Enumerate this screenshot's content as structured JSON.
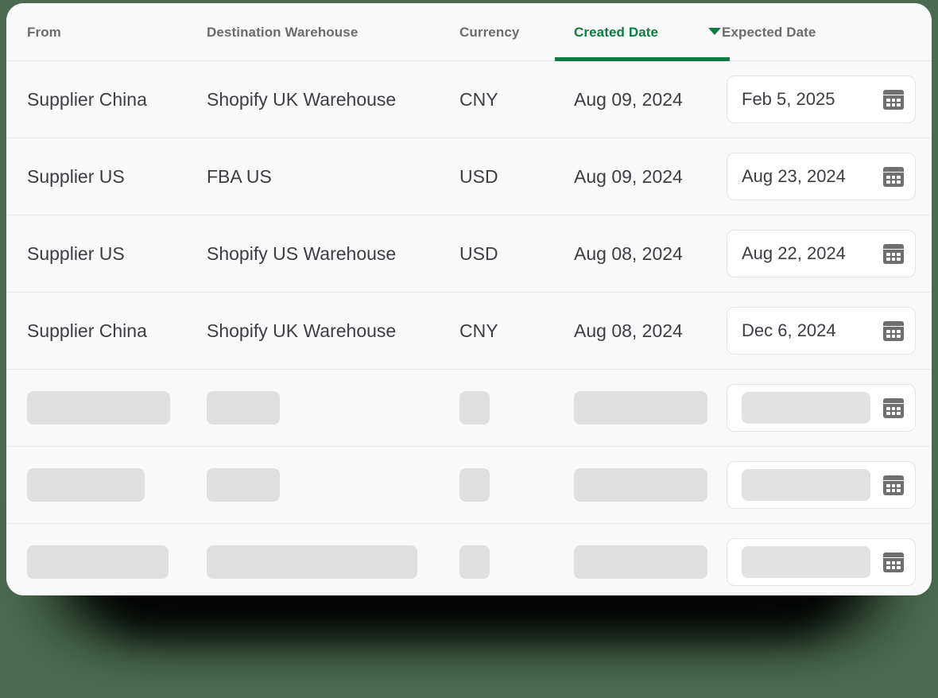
{
  "background_color": "#4a6b50",
  "accent_color": "#0e7b41",
  "table": {
    "columns": [
      {
        "key": "from",
        "label": "From",
        "sorted": false
      },
      {
        "key": "dest",
        "label": "Destination Warehouse",
        "sorted": false
      },
      {
        "key": "currency",
        "label": "Currency",
        "sorted": false
      },
      {
        "key": "created",
        "label": "Created Date",
        "sorted": true,
        "sort_direction": "desc",
        "sort_icon": "caret-down-icon"
      },
      {
        "key": "expected",
        "label": "Expected Date",
        "sorted": false
      }
    ],
    "rows": [
      {
        "loaded": true,
        "from": "Supplier China",
        "dest": "Shopify UK Warehouse",
        "currency": "CNY",
        "created": "Aug 09, 2024",
        "expected": "Feb 5, 2025",
        "expected_icon": "calendar-icon"
      },
      {
        "loaded": true,
        "from": "Supplier US",
        "dest": "FBA US",
        "currency": "USD",
        "created": "Aug 09, 2024",
        "expected": "Aug 23, 2024",
        "expected_icon": "calendar-icon"
      },
      {
        "loaded": true,
        "from": "Supplier US",
        "dest": "Shopify US Warehouse",
        "currency": "USD",
        "created": "Aug 08, 2024",
        "expected": "Aug 22, 2024",
        "expected_icon": "calendar-icon"
      },
      {
        "loaded": true,
        "from": "Supplier China",
        "dest": "Shopify UK Warehouse",
        "currency": "CNY",
        "created": "Aug 08, 2024",
        "expected": "Dec 6, 2024",
        "expected_icon": "calendar-icon"
      },
      {
        "loaded": false,
        "from": "",
        "dest": "",
        "currency": "",
        "created": "",
        "expected": "",
        "expected_icon": "calendar-icon",
        "skeleton_widths": {
          "from": 180,
          "dest": 92,
          "currency": 38,
          "created": 168,
          "expected": 162
        }
      },
      {
        "loaded": false,
        "from": "",
        "dest": "",
        "currency": "",
        "created": "",
        "expected": "",
        "expected_icon": "calendar-icon",
        "skeleton_widths": {
          "from": 148,
          "dest": 92,
          "currency": 38,
          "created": 168,
          "expected": 162
        }
      },
      {
        "loaded": false,
        "from": "",
        "dest": "",
        "currency": "",
        "created": "",
        "expected": "",
        "expected_icon": "calendar-icon",
        "skeleton_widths": {
          "from": 178,
          "dest": 265,
          "currency": 38,
          "created": 168,
          "expected": 162
        }
      }
    ]
  }
}
